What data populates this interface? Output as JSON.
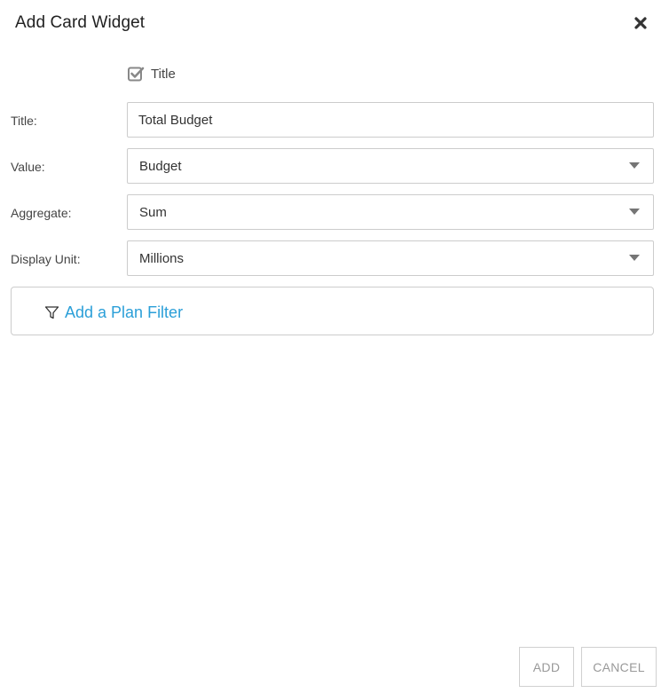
{
  "header": {
    "title": "Add Card Widget",
    "close_icon": "close-icon"
  },
  "show_title": {
    "label": "Title",
    "checked": true
  },
  "form": {
    "title": {
      "label": "Title:",
      "value": "Total Budget"
    },
    "value": {
      "label": "Value:",
      "selected": "Budget"
    },
    "aggregate": {
      "label": "Aggregate:",
      "selected": "Sum"
    },
    "display_unit": {
      "label": "Display Unit:",
      "selected": "Millions"
    }
  },
  "filter": {
    "label": "Add a Plan Filter",
    "icon": "filter-icon"
  },
  "footer": {
    "add_label": "ADD",
    "cancel_label": "CANCEL"
  },
  "colors": {
    "link": "#2b9fd8",
    "border": "#cccccc",
    "caret": "#757575",
    "checkbox": "#888888"
  }
}
